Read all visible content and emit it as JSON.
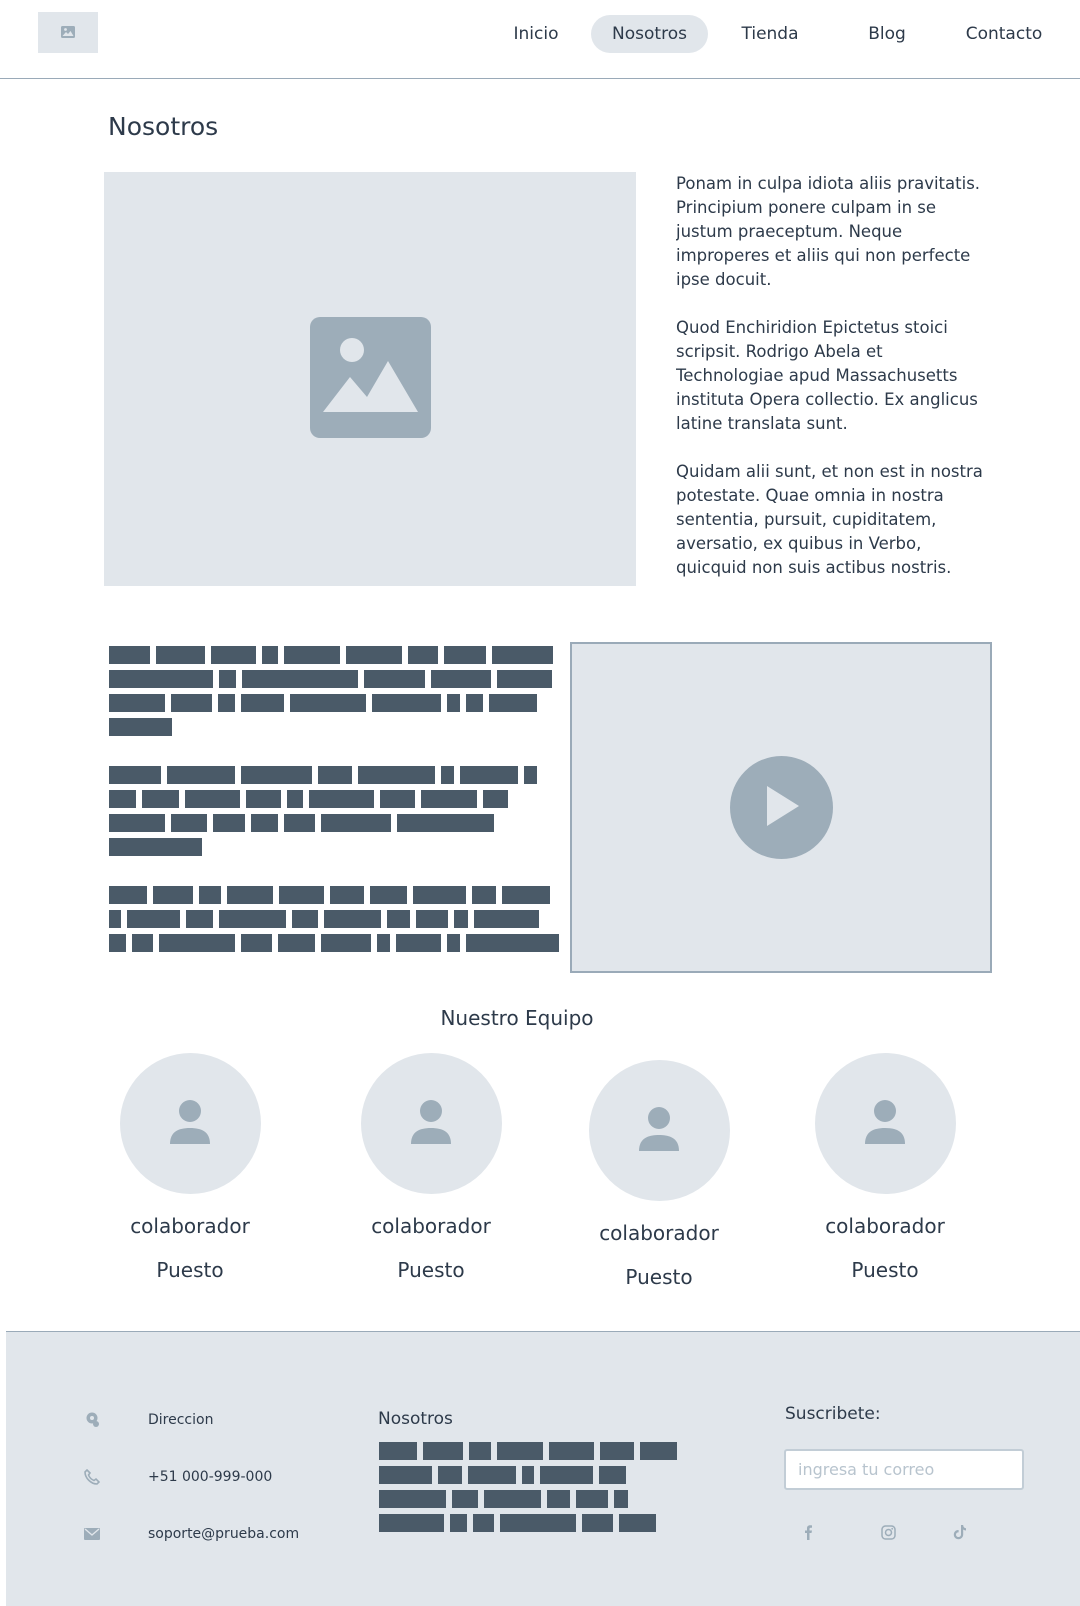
{
  "nav": {
    "items": [
      {
        "label": "Inicio"
      },
      {
        "label": "Nosotros"
      },
      {
        "label": "Tienda"
      },
      {
        "label": "Blog"
      },
      {
        "label": "Contacto"
      }
    ],
    "active": "Nosotros"
  },
  "page": {
    "title": "Nosotros",
    "paragraphs": [
      "Ponam in culpa idiota aliis pravitatis. Principium ponere culpam in se justum praeceptum. Neque improperes et aliis qui non perfecte ipse docuit.",
      "Quod Enchiridion Epictetus stoici scripsit. Rodrigo Abela et Technologiae apud Massachusetts instituta Opera collectio. Ex anglicus latine translata sunt.",
      "Quidam alii sunt, et non est in nostra potestate. Quae omnia in nostra sententia, pursuit, cupiditatem, aversatio, ex quibus in Verbo, quicquid non suis actibus nostris. Non sunt in"
    ]
  },
  "team": {
    "title": "Nuestro Equipo",
    "members": [
      {
        "name": "colaborador",
        "role": "Puesto"
      },
      {
        "name": "colaborador",
        "role": "Puesto"
      },
      {
        "name": "colaborador",
        "role": "Puesto"
      },
      {
        "name": "colaborador",
        "role": "Puesto"
      }
    ]
  },
  "footer": {
    "contact": {
      "address": "Direccion",
      "phone": "+51 000-999-000",
      "email": "soporte@prueba.com"
    },
    "about_title": "Nosotros",
    "subscribe_title": "Suscribete:",
    "subscribe_placeholder": "ingresa tu correo",
    "social": [
      "facebook-icon",
      "instagram-icon",
      "tiktok-icon"
    ]
  },
  "colors": {
    "placeholder_bg": "#e1e6eb",
    "icon_gray": "#9dadb9",
    "redacted": "#4a5a68",
    "text": "#2d3a4a"
  }
}
